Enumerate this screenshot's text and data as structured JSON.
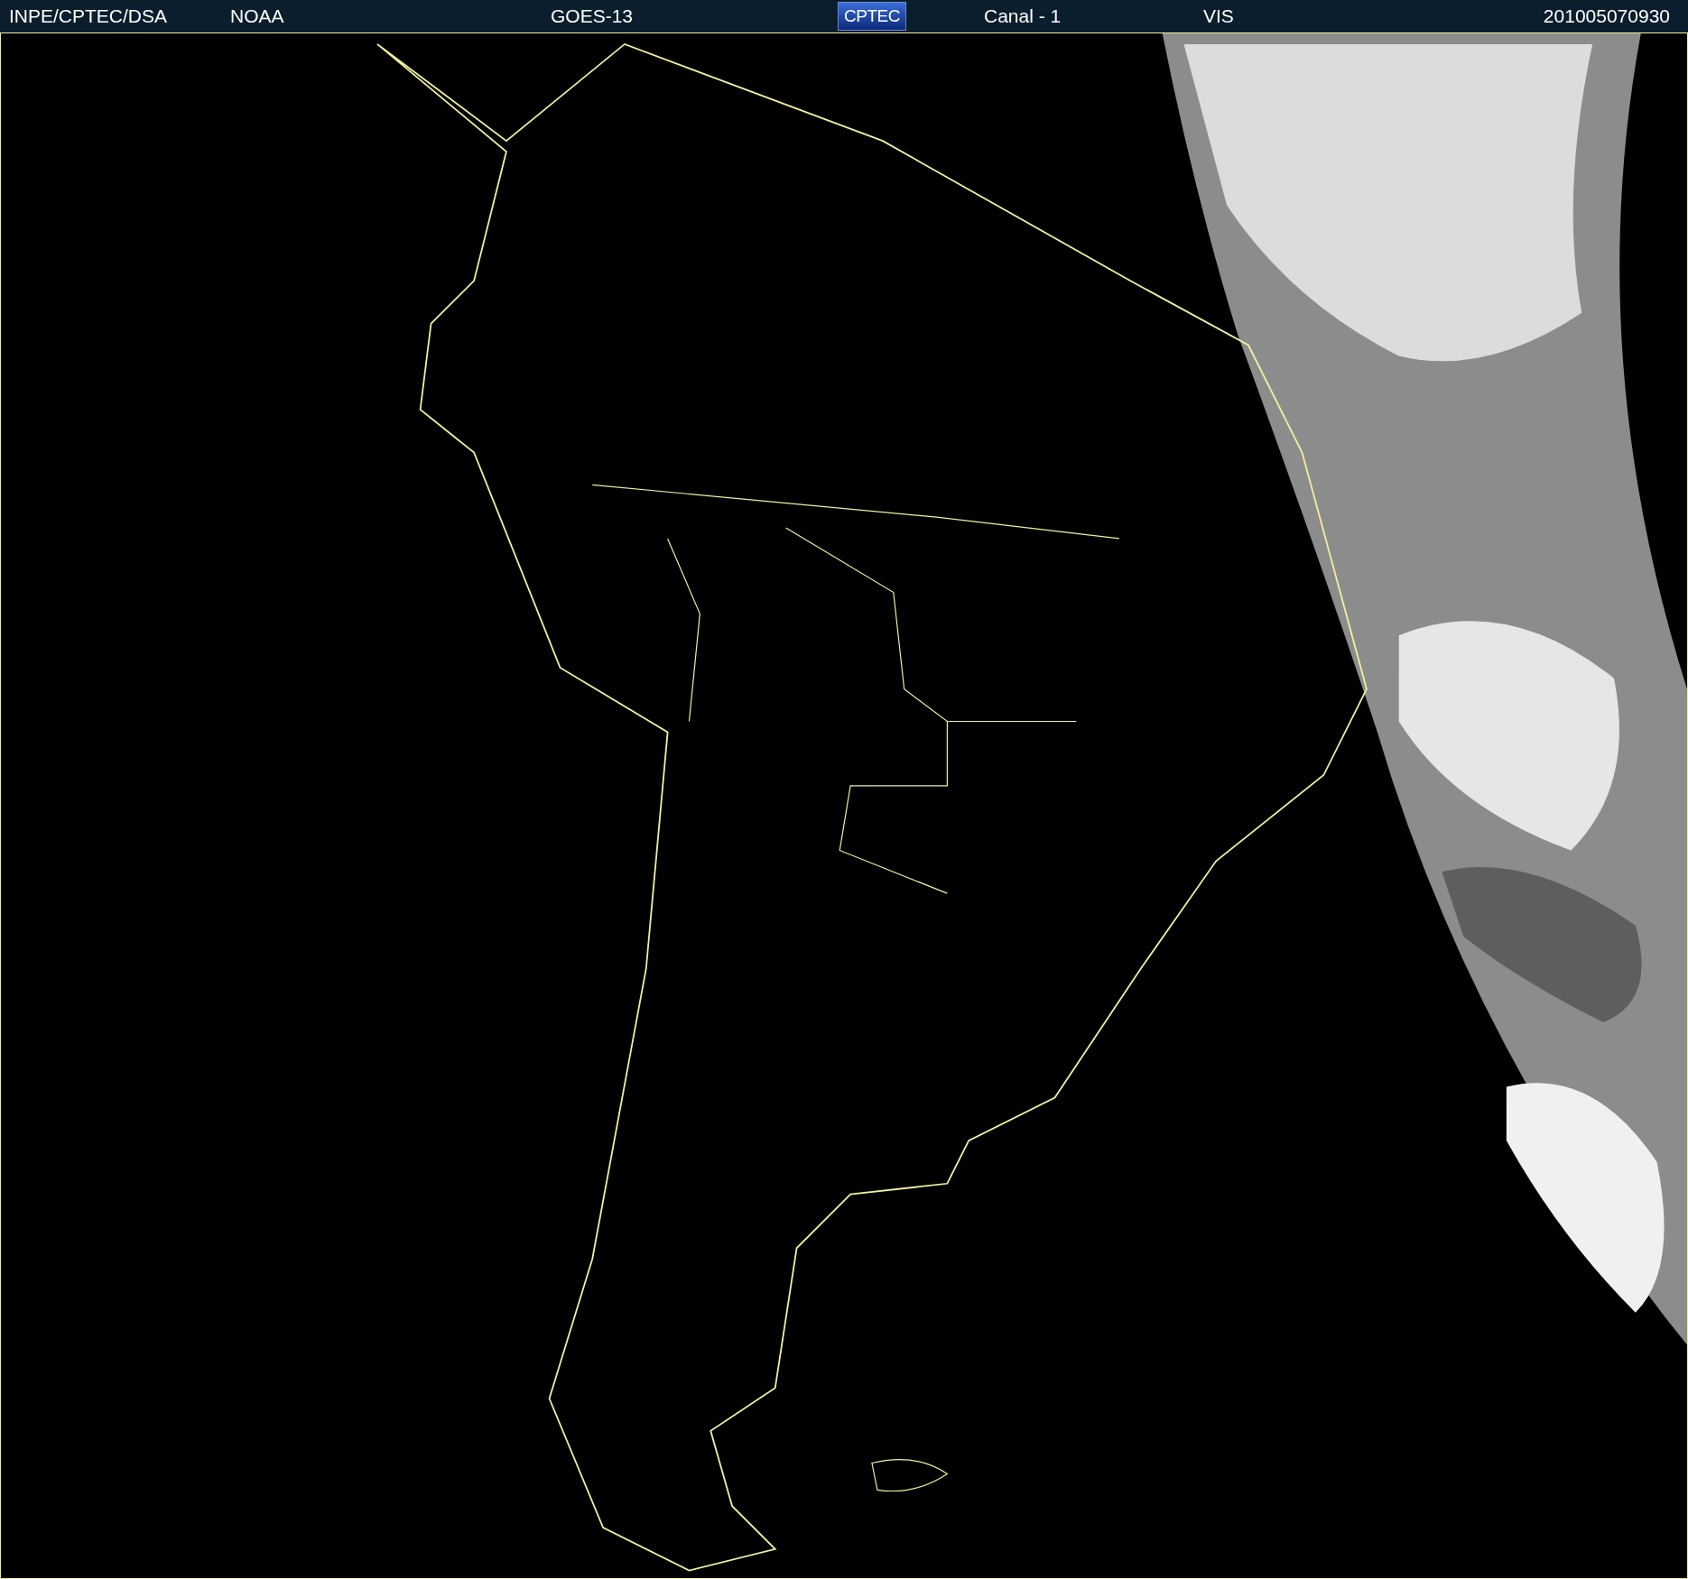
{
  "header": {
    "items": [
      {
        "kind": "text",
        "text": "INPE/CPTEC/DSA"
      },
      {
        "kind": "text",
        "text": "NOAA"
      },
      {
        "kind": "text",
        "text": "GOES-13"
      },
      {
        "kind": "logo",
        "text": "CPTEC"
      },
      {
        "kind": "text",
        "text": "Canal - 1"
      },
      {
        "kind": "text",
        "text": "VIS"
      },
      {
        "kind": "text",
        "text": "201005070930"
      }
    ]
  }
}
